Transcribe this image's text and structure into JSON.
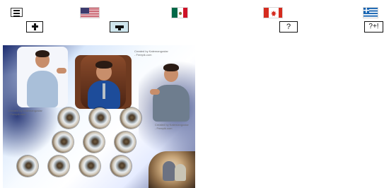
{
  "top_row": {
    "icons": [
      "menu-icon",
      "usa-flag-icon",
      "mexico-flag-icon",
      "canada-flag-icon",
      "greece-flag-icon"
    ]
  },
  "second_row": {
    "cross_icon": "cross-icon",
    "cap_icon": "graduation-cap-icon",
    "help_label": "?",
    "help_plus_label": "?+!"
  },
  "hero": {
    "caption_left": "Created by Katemangostar\n- Freepik.com",
    "caption_top": "Created by Katemangostar\n- Freepik.com",
    "caption_right": "Created by Katemangostar\n- Freepik.com"
  }
}
